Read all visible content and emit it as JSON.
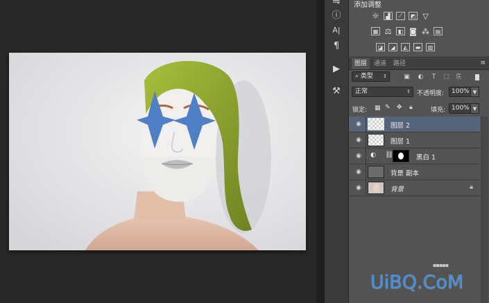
{
  "adjustments": {
    "title": "添加调整"
  },
  "tabs": [
    {
      "label": "图层"
    },
    {
      "label": "通道"
    },
    {
      "label": "路径"
    }
  ],
  "filter": {
    "kind_label": "类型"
  },
  "blend": {
    "mode": "正常",
    "opacity_label": "不透明度:",
    "opacity_value": "100%"
  },
  "lock": {
    "label": "锁定:",
    "fill_label": "填充:",
    "fill_value": "100%"
  },
  "layers": [
    {
      "name": "图层 2",
      "selected": true
    },
    {
      "name": "图层 1",
      "selected": false
    },
    {
      "name": "黑白 1",
      "selected": false
    },
    {
      "name": "背景 副本",
      "selected": false
    },
    {
      "name": "背景",
      "selected": false,
      "locked": true
    }
  ],
  "watermark": {
    "text": "UiBQ.CoM"
  },
  "colors": {
    "panel": "#535353",
    "selected_layer": "#56647a",
    "canvas_bg": "#282828",
    "paint_blue": "#4f7fc4",
    "hair_green": "#9bb431",
    "watermark": "#3b8ee0"
  },
  "icons": {
    "eye": "eye-icon",
    "lock": "lock-icon",
    "chain": "chain-link-icon",
    "menu": "panel-menu-icon"
  }
}
